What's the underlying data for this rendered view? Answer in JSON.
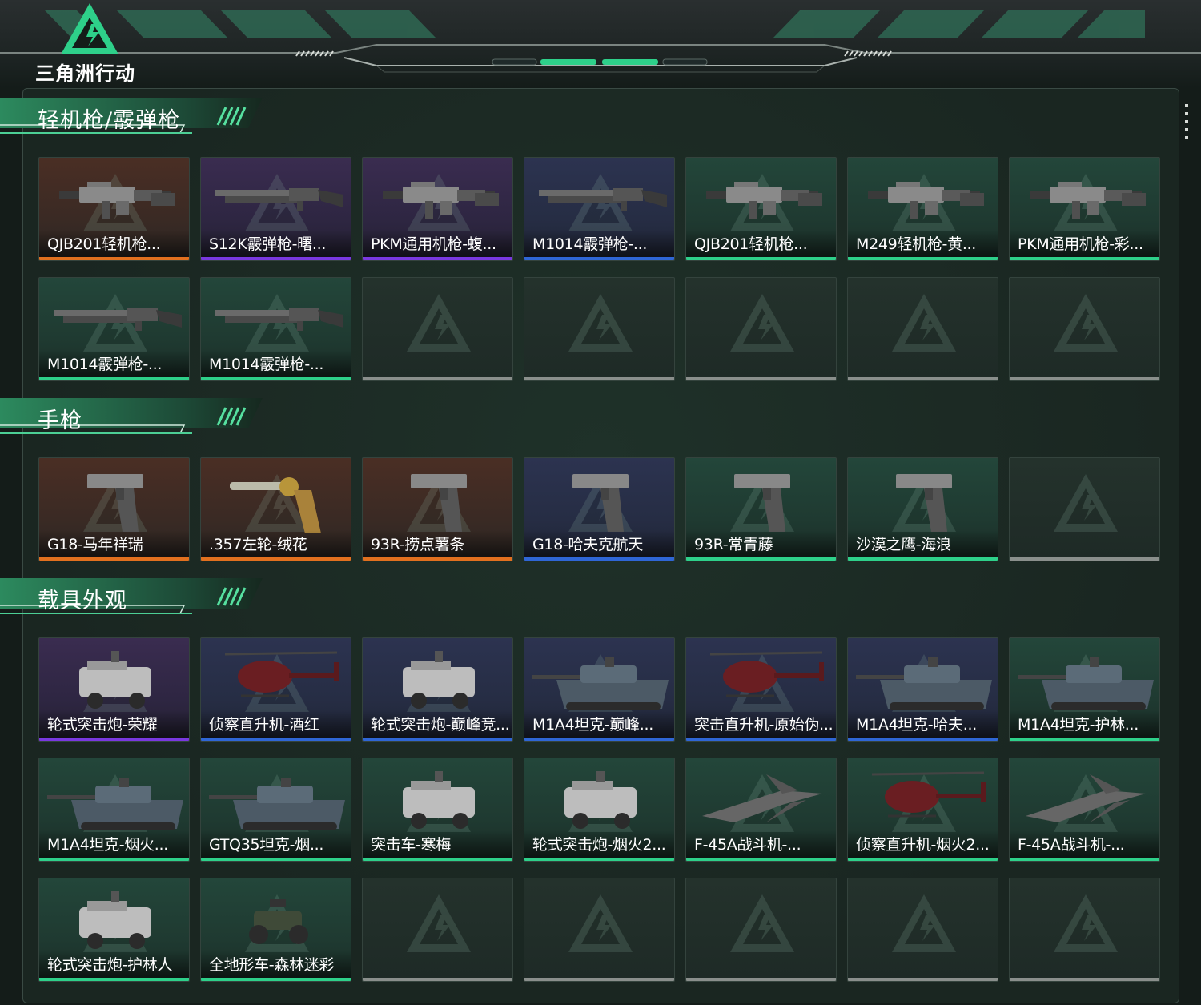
{
  "app": {
    "logo_text": "三角洲行动"
  },
  "colors": {
    "orange": "#e2701f",
    "purple": "#7a38e0",
    "blue": "#2f66d6",
    "green": "#2ed08a",
    "empty": "#8a8f8c",
    "accent": "#2ed08a"
  },
  "sections": [
    {
      "title": "轻机枪/霰弹枪",
      "items": [
        {
          "label": "QJB201轻机枪...",
          "rarity": "orange",
          "icon": "lmg-icon"
        },
        {
          "label": "S12K霰弹枪-曙...",
          "rarity": "purple",
          "icon": "shotgun-icon"
        },
        {
          "label": "PKM通用机枪-蝮...",
          "rarity": "purple",
          "icon": "lmg-icon"
        },
        {
          "label": "M1014霰弹枪-...",
          "rarity": "blue",
          "icon": "shotgun-icon"
        },
        {
          "label": "QJB201轻机枪...",
          "rarity": "green",
          "icon": "lmg-icon"
        },
        {
          "label": "M249轻机枪-黄...",
          "rarity": "green",
          "icon": "lmg-icon"
        },
        {
          "label": "PKM通用机枪-彩...",
          "rarity": "green",
          "icon": "lmg-icon"
        },
        {
          "label": "M1014霰弹枪-...",
          "rarity": "green",
          "icon": "shotgun-icon"
        },
        {
          "label": "M1014霰弹枪-...",
          "rarity": "green",
          "icon": "shotgun-icon"
        },
        {
          "label": "",
          "rarity": "empty",
          "icon": ""
        },
        {
          "label": "",
          "rarity": "empty",
          "icon": ""
        },
        {
          "label": "",
          "rarity": "empty",
          "icon": ""
        },
        {
          "label": "",
          "rarity": "empty",
          "icon": ""
        },
        {
          "label": "",
          "rarity": "empty",
          "icon": ""
        }
      ]
    },
    {
      "title": "手枪",
      "items": [
        {
          "label": "G18-马年祥瑞",
          "rarity": "orange",
          "icon": "pistol-icon"
        },
        {
          "label": ".357左轮-绒花",
          "rarity": "orange",
          "icon": "revolver-icon"
        },
        {
          "label": "93R-捞点薯条",
          "rarity": "orange",
          "icon": "pistol-icon"
        },
        {
          "label": "G18-哈夫克航天",
          "rarity": "blue",
          "icon": "pistol-icon"
        },
        {
          "label": "93R-常青藤",
          "rarity": "green",
          "icon": "pistol-icon"
        },
        {
          "label": "沙漠之鹰-海浪",
          "rarity": "green",
          "icon": "pistol-icon"
        },
        {
          "label": "",
          "rarity": "empty",
          "icon": ""
        }
      ]
    },
    {
      "title": "载具外观",
      "items": [
        {
          "label": "轮式突击炮-荣耀",
          "rarity": "purple",
          "icon": "armored-car-icon"
        },
        {
          "label": "侦察直升机-酒红",
          "rarity": "blue",
          "icon": "helicopter-icon"
        },
        {
          "label": "轮式突击炮-巅峰竞...",
          "rarity": "blue",
          "icon": "armored-car-icon"
        },
        {
          "label": "M1A4坦克-巅峰...",
          "rarity": "blue",
          "icon": "tank-icon"
        },
        {
          "label": "突击直升机-原始伪...",
          "rarity": "blue",
          "icon": "helicopter-icon"
        },
        {
          "label": "M1A4坦克-哈夫...",
          "rarity": "blue",
          "icon": "tank-icon"
        },
        {
          "label": "M1A4坦克-护林...",
          "rarity": "green",
          "icon": "tank-icon"
        },
        {
          "label": "M1A4坦克-烟火...",
          "rarity": "green",
          "icon": "tank-icon"
        },
        {
          "label": "GTQ35坦克-烟...",
          "rarity": "green",
          "icon": "tank-icon"
        },
        {
          "label": "突击车-寒梅",
          "rarity": "green",
          "icon": "armored-car-icon"
        },
        {
          "label": "轮式突击炮-烟火2...",
          "rarity": "green",
          "icon": "armored-car-icon"
        },
        {
          "label": "F-45A战斗机-...",
          "rarity": "green",
          "icon": "jet-icon"
        },
        {
          "label": "侦察直升机-烟火2...",
          "rarity": "green",
          "icon": "helicopter-icon"
        },
        {
          "label": "F-45A战斗机-...",
          "rarity": "green",
          "icon": "jet-icon"
        },
        {
          "label": "轮式突击炮-护林人",
          "rarity": "green",
          "icon": "armored-car-icon"
        },
        {
          "label": "全地形车-森林迷彩",
          "rarity": "green",
          "icon": "atv-icon"
        },
        {
          "label": "",
          "rarity": "empty",
          "icon": ""
        },
        {
          "label": "",
          "rarity": "empty",
          "icon": ""
        },
        {
          "label": "",
          "rarity": "empty",
          "icon": ""
        },
        {
          "label": "",
          "rarity": "empty",
          "icon": ""
        },
        {
          "label": "",
          "rarity": "empty",
          "icon": ""
        }
      ]
    }
  ]
}
